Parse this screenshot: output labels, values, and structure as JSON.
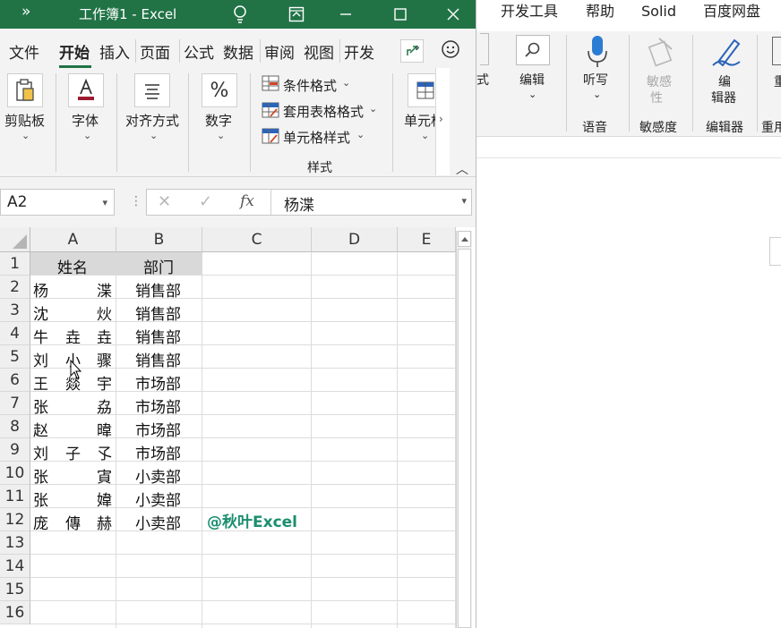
{
  "bg": {
    "tabs": [
      "开发工具",
      "帮助",
      "Solid",
      "百度网盘"
    ],
    "partial_label": "式",
    "edit_label": "编辑",
    "listen_label": "听写",
    "voice_caption": "语音",
    "sens_line1": "敏感",
    "sens_line2": "性",
    "sens_caption": "敏感度",
    "editor_line1": "编",
    "editor_line2": "辑器",
    "editor_caption": "编辑器",
    "reuse_char": "重",
    "reuse_caption": "重用"
  },
  "titlebar": {
    "chevron": "»",
    "title": "工作簿1  -  Excel",
    "bg_color": "#217346"
  },
  "tabs": {
    "file": "文件",
    "home": "开始",
    "insert": "插入",
    "page_layout": "页面",
    "formulas": "公式",
    "data": "数据",
    "review": "审阅",
    "view": "视图",
    "developer": "开发"
  },
  "ribbon": {
    "clipboard": "剪贴板",
    "font": "字体",
    "alignment": "对齐方式",
    "number": "数字",
    "conditional_format": "条件格式",
    "format_table": "套用表格格式",
    "cell_styles": "单元格样式",
    "styles_caption": "样式",
    "cells": "单元格"
  },
  "formula_bar": {
    "name_box": "A2",
    "fx": "fx",
    "cancel": "✕",
    "enter": "✓",
    "content": "杨渫"
  },
  "grid": {
    "columns": [
      "A",
      "B",
      "C",
      "D",
      "E"
    ],
    "rows": [
      "1",
      "2",
      "3",
      "4",
      "5",
      "6",
      "7",
      "8",
      "9",
      "10",
      "11",
      "12",
      "13",
      "14",
      "15",
      "16"
    ],
    "header_name": "姓名",
    "header_dept": "部门",
    "names": [
      [
        "杨",
        "",
        "渫"
      ],
      [
        "沈",
        "",
        "炏"
      ],
      [
        "牛",
        "垚",
        "垚"
      ],
      [
        "刘",
        "小",
        "骤"
      ],
      [
        "王",
        "燚",
        "宇"
      ],
      [
        "张",
        "",
        "劦"
      ],
      [
        "赵",
        "",
        "暐"
      ],
      [
        "刘",
        "子",
        "孓"
      ],
      [
        "张",
        "",
        "寊"
      ],
      [
        "张",
        "",
        "媁"
      ],
      [
        "庞",
        "傳",
        "赫"
      ]
    ],
    "depts": [
      "销售部",
      "销售部",
      "销售部",
      "销售部",
      "市场部",
      "市场部",
      "市场部",
      "市场部",
      "小卖部",
      "小卖部",
      "小卖部"
    ],
    "watermark": "@秋叶Excel",
    "watermark_color": "#1a8f6e"
  }
}
